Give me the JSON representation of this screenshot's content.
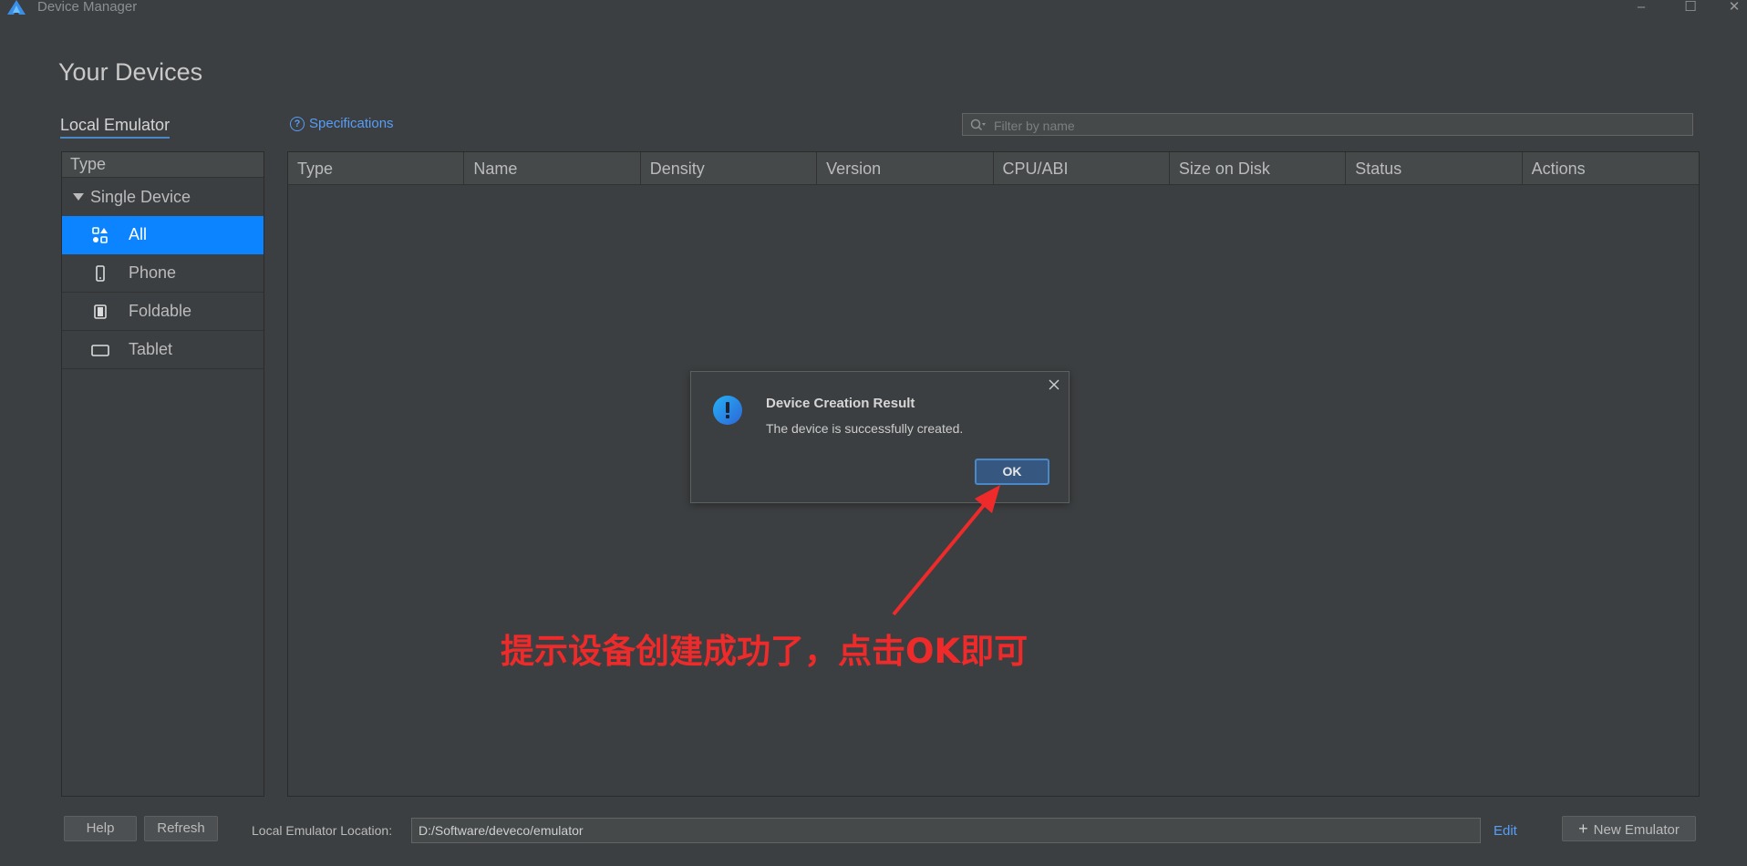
{
  "window": {
    "title": "Device Manager",
    "controls": {
      "minimize": "–",
      "maximize": "☐",
      "close": "✕"
    }
  },
  "page": {
    "title": "Your Devices"
  },
  "tabs": {
    "local": "Local Emulator"
  },
  "specifications": {
    "label": "Specifications"
  },
  "filter": {
    "placeholder": "Filter by name",
    "value": ""
  },
  "type_panel": {
    "header": "Type",
    "group": "Single Device",
    "items": [
      {
        "label": "All",
        "icon": "grid-shapes-icon",
        "selected": true
      },
      {
        "label": "Phone",
        "icon": "phone-icon",
        "selected": false
      },
      {
        "label": "Foldable",
        "icon": "foldable-icon",
        "selected": false
      },
      {
        "label": "Tablet",
        "icon": "tablet-icon",
        "selected": false
      }
    ]
  },
  "table": {
    "columns": [
      "Type",
      "Name",
      "Density",
      "Version",
      "CPU/ABI",
      "Size on Disk",
      "Status",
      "Actions"
    ],
    "rows": []
  },
  "dialog": {
    "title": "Device Creation Result",
    "message": "The device is successfully created.",
    "ok_label": "OK",
    "icon": "warning-exclamation-icon"
  },
  "annotation": {
    "text": "提示设备创建成功了，点击OK即可",
    "color": "#ee2a2a"
  },
  "footer": {
    "help_label": "Help",
    "refresh_label": "Refresh",
    "location_label": "Local Emulator Location:",
    "location_value": "D:/Software/deveco/emulator",
    "edit_label": "Edit",
    "new_emulator_label": "New Emulator"
  },
  "colors": {
    "background": "#3c3f41",
    "selected": "#0d84ff",
    "link": "#589df6",
    "ok_button": "#365880"
  }
}
